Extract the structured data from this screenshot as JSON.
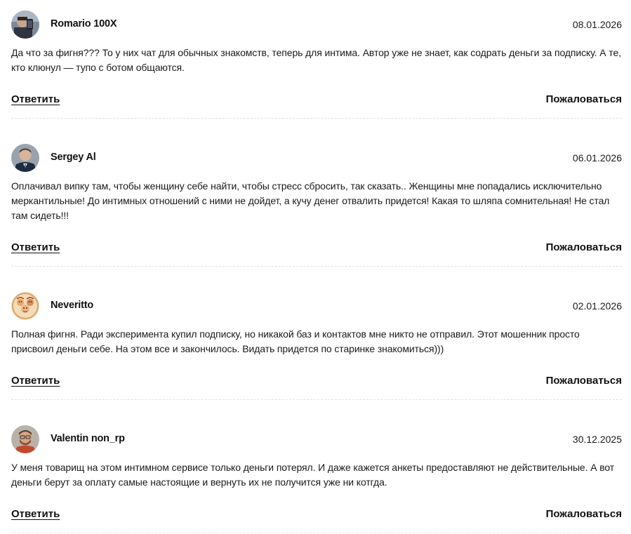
{
  "comments": [
    {
      "author": "Romario 100X",
      "date": "08.01.2026",
      "text": "Да что за фигня??? То у них чат для обычных знакомств, теперь для интима. Автор уже не знает, как содрать деньги за подписку. А те, кто клюнул — тупо с ботом общаются.",
      "reply_label": "Ответить",
      "report_label": "Пожаловаться",
      "avatar_icon": "user-photo-avatar-icon"
    },
    {
      "author": "Sergey Al",
      "date": "06.01.2026",
      "text": "Оплачивал випку там, чтобы женщину себе найти, чтобы стресс сбросить, так сказать.. Женщины мне попадались исключительно меркантильные! До интимных отношений с ними не дойдет, а кучу денег отвалить придется! Какая то шляпа сомнительная! Не стал там сидеть!!!",
      "reply_label": "Ответить",
      "report_label": "Пожаловаться",
      "avatar_icon": "user-photo-avatar-icon"
    },
    {
      "author": "Neveritto",
      "date": "02.01.2026",
      "text": "Полная фигня. Ради эксперимента купил подписку, но никакой баз и контактов мне никто не отправил. Этот мошенник просто присвоил деньги себе. На этом все и закончилось. Видать придется по старинке знакомиться)))",
      "reply_label": "Ответить",
      "report_label": "Пожаловаться",
      "avatar_icon": "illustrated-avatar-icon"
    },
    {
      "author": "Valentin non_rp",
      "date": "30.12.2025",
      "text": "У меня товарищ на этом интимном сервисе только деньги потерял. И даже кажется анкеты предоставляют не действительные. А вот деньги берут за оплату самые настоящие и вернуть их не получится уже ни котгда.",
      "reply_label": "Ответить",
      "report_label": "Пожаловаться",
      "avatar_icon": "user-photo-avatar-icon"
    }
  ],
  "colors": {
    "text": "#1a1a1a",
    "divider": "#e2e2e2",
    "background": "#ffffff"
  }
}
